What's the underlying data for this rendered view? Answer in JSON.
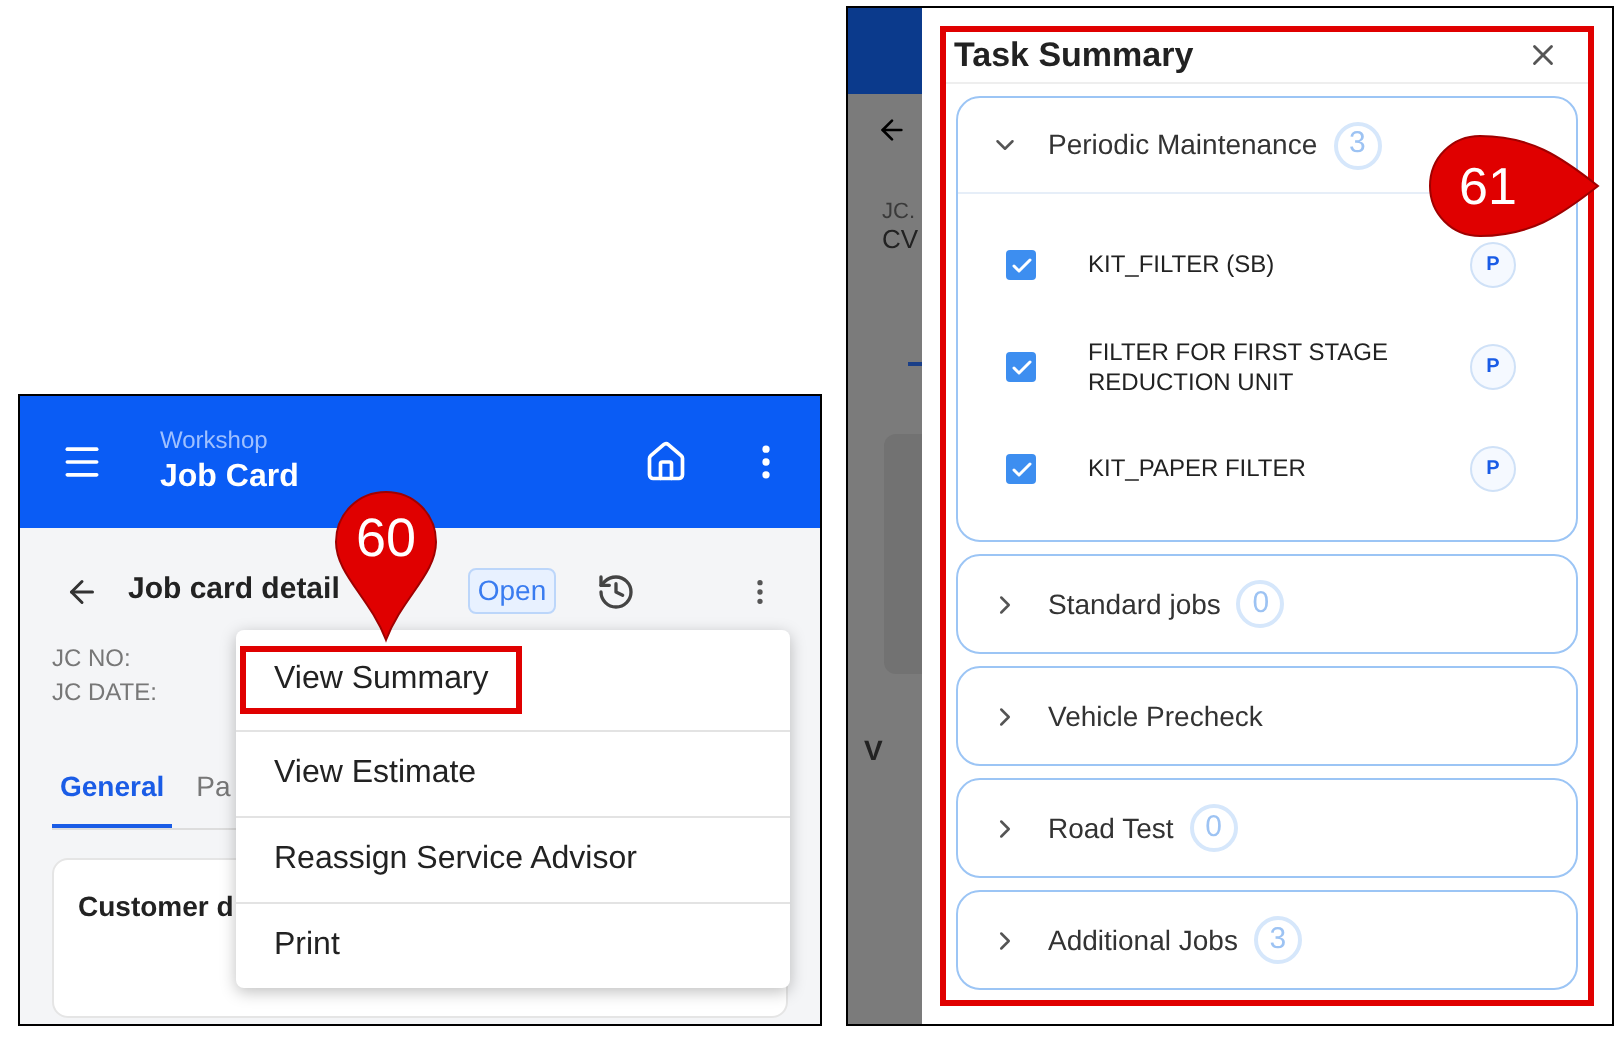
{
  "left_screen": {
    "header": {
      "subtitle": "Workshop",
      "title": "Job Card"
    },
    "page_title": "Job card detail",
    "status_badge": "Open",
    "fields": [
      {
        "label": "JC NO:"
      },
      {
        "label": "JC DATE:"
      }
    ],
    "tabs": [
      {
        "label": "General",
        "selected": true
      },
      {
        "label": "Pa",
        "selected": false
      }
    ],
    "card_title": "Customer d",
    "menu": [
      {
        "label": "View Summary",
        "highlighted": true
      },
      {
        "label": "View Estimate",
        "highlighted": false
      },
      {
        "label": "Reassign Service Advisor",
        "highlighted": false
      },
      {
        "label": "Print",
        "highlighted": false
      }
    ]
  },
  "right_screen": {
    "background_texts": [
      {
        "text": "JC."
      },
      {
        "text": "CV"
      },
      {
        "text": "V"
      }
    ],
    "dialog": {
      "title": "Task Summary",
      "sections": [
        {
          "title": "Periodic Maintenance",
          "count": "3",
          "expanded": true,
          "items": [
            {
              "label": "KIT_FILTER (SB)",
              "checked": true,
              "badge": "P"
            },
            {
              "label": "FILTER FOR FIRST STAGE REDUCTION UNIT",
              "checked": true,
              "badge": "P"
            },
            {
              "label": "KIT_PAPER FILTER",
              "checked": true,
              "badge": "P"
            }
          ]
        },
        {
          "title": "Standard jobs",
          "count": "0",
          "expanded": false
        },
        {
          "title": "Vehicle Precheck",
          "expanded": false
        },
        {
          "title": "Road Test",
          "count": "0",
          "expanded": false
        },
        {
          "title": "Additional Jobs",
          "count": "3",
          "expanded": false
        }
      ]
    }
  },
  "callouts": [
    {
      "label": "60",
      "kind": "pin"
    },
    {
      "label": "61",
      "kind": "tag"
    }
  ]
}
